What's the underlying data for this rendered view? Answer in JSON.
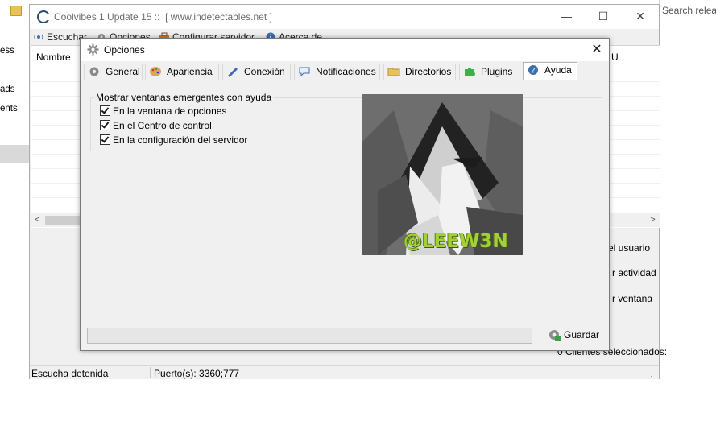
{
  "background": {
    "sidebar_items": [
      "ess",
      "ads",
      "ents"
    ],
    "search_placeholder": "Search releas"
  },
  "main_window": {
    "title": "Coolvibes 1 Update 15 ::",
    "subtitle": "[ www.indetectables.net ]",
    "controls": {
      "minimize": "—",
      "maximize": "☐",
      "close": "✕"
    },
    "menu": {
      "escuchar": "Escuchar",
      "opciones": "Opciones",
      "configurar": "Configurar servidor",
      "acerca": "Acerca de"
    },
    "columns": {
      "nombre": "Nombre",
      "right_partial": "U"
    },
    "side_labels": {
      "usuario": "el usuario",
      "actividad": "r actividad",
      "ventana": "r ventana",
      "seleccionados": "0 Clientes seleccionados:"
    },
    "status": {
      "escucha": "Escucha detenida",
      "puertos": "Puerto(s): 3360;777"
    }
  },
  "dialog": {
    "title": "Opciones",
    "close": "✕",
    "tabs": [
      {
        "label": "General",
        "icon": "gear-icon"
      },
      {
        "label": "Apariencia",
        "icon": "palette-icon"
      },
      {
        "label": "Conexión",
        "icon": "plug-icon"
      },
      {
        "label": "Notificaciones",
        "icon": "speech-bubble-icon"
      },
      {
        "label": "Directorios",
        "icon": "folder-icon"
      },
      {
        "label": "Plugins",
        "icon": "puzzle-icon"
      },
      {
        "label": "Ayuda",
        "icon": "help-icon"
      }
    ],
    "active_tab": "Ayuda",
    "group_title": "Mostrar ventanas emergentes con ayuda",
    "checkboxes": [
      {
        "label": "En la ventana de opciones",
        "checked": true
      },
      {
        "label": "En el Centro de control",
        "checked": true
      },
      {
        "label": "En la configuración del servidor",
        "checked": true
      }
    ],
    "image_watermark": "@LEEW3N",
    "save_label": "Guardar"
  },
  "colors": {
    "dialog_bg": "#f0f0f0",
    "watermark": "#a4d037",
    "image_bg": "#6f6f6f"
  }
}
